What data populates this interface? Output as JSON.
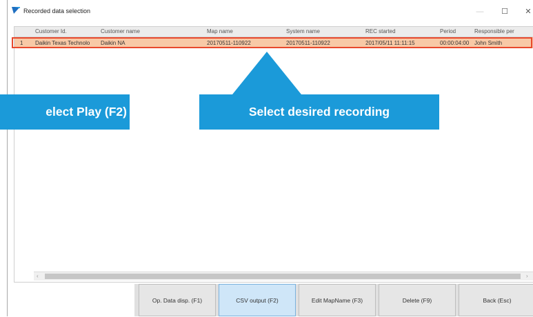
{
  "window": {
    "title": "Recorded data selection",
    "controls": {
      "minimize": "—",
      "maximize": "☐",
      "close": "✕"
    }
  },
  "table": {
    "headers": [
      "Customer Id.",
      "Customer name",
      "Map name",
      "System name",
      "REC started",
      "Period",
      "Responsible per"
    ],
    "rows": [
      {
        "index": "1",
        "customer_id": "Daikin Texas Technolo",
        "customer_name": "Daikin NA",
        "map_name": "20170511-110922",
        "system_name": "20170511-110922",
        "rec_started": "2017/05/11 11:11:15",
        "period": "00:00:04:00",
        "responsible": "John Smith"
      }
    ]
  },
  "scrollbar": {
    "left_arrow": "‹",
    "right_arrow": "›"
  },
  "buttons": {
    "op_data": "Op. Data disp. (F1)",
    "csv_output": "CSV output (F2)",
    "edit_mapname": "Edit MapName (F3)",
    "delete": "Delete (F9)",
    "back": "Back (Esc)"
  },
  "callouts": {
    "left": "elect Play (F2)",
    "right": "Select desired recording"
  },
  "colors": {
    "callout": "#1b9ad9",
    "row_selected": "#f8c9a6",
    "highlight_border": "#e8482c",
    "active_button": "#cfe6f8"
  }
}
